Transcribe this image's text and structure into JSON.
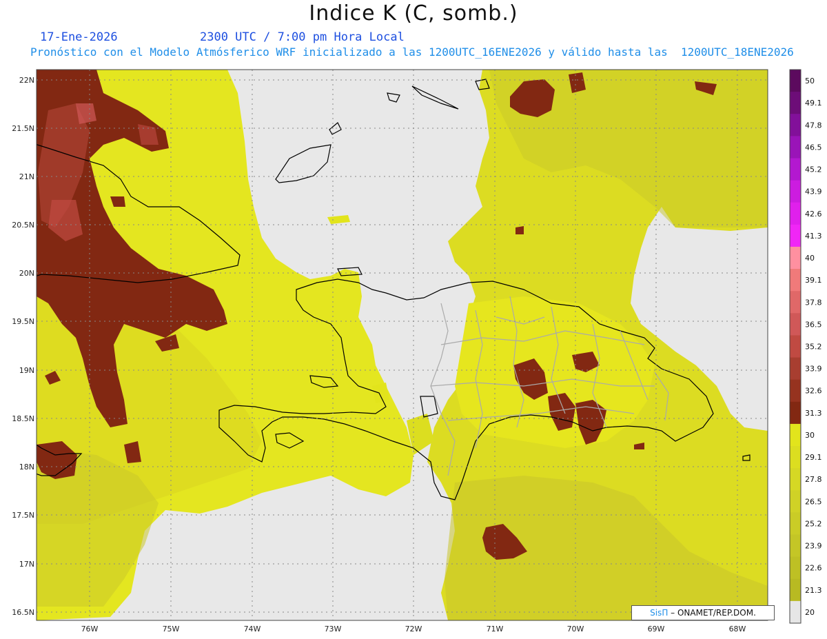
{
  "header": {
    "title": "Indice K (C, somb.)",
    "date": "17-Ene-2026",
    "time": "2300 UTC / 7:00 pm Hora Local",
    "subtitle": "Pronóstico con el Modelo Atmósferico WRF inicializado a las 1200UTC_16ENE2026 y válido hasta las  1200UTC_18ENE2026"
  },
  "map": {
    "lat_ticks": [
      "22N",
      "21.5N",
      "21N",
      "20.5N",
      "20N",
      "19.5N",
      "19N",
      "18.5N",
      "18N",
      "17.5N",
      "17N",
      "16.5N"
    ],
    "lon_ticks": [
      "76W",
      "75W",
      "74W",
      "73W",
      "72W",
      "71W",
      "70W",
      "69W",
      "68W"
    ]
  },
  "colorbar": {
    "levels": [
      "50",
      "49.1",
      "47.8",
      "46.5",
      "45.2",
      "43.9",
      "42.6",
      "41.3",
      "40",
      "39.1",
      "37.8",
      "36.5",
      "35.2",
      "33.9",
      "32.6",
      "31.3",
      "30",
      "29.1",
      "27.8",
      "26.5",
      "25.2",
      "23.9",
      "22.6",
      "21.3",
      "20"
    ],
    "colors": [
      "#5c0a5e",
      "#6d0d78",
      "#82109a",
      "#9a14b8",
      "#b318d0",
      "#cc1ce0",
      "#e020ec",
      "#f026f6",
      "#ff90a0",
      "#f07a7a",
      "#e06868",
      "#d05858",
      "#c04a42",
      "#a83e30",
      "#96331f",
      "#822812",
      "#e2e41c",
      "#dcde20",
      "#d6d824",
      "#d0d226",
      "#cacc26",
      "#c4c626",
      "#bec024",
      "#b8ba22",
      "#e6e6e6"
    ]
  },
  "credit": {
    "sis": "SisΠ",
    "rest": "– ONAMET/REP.DOM."
  }
}
